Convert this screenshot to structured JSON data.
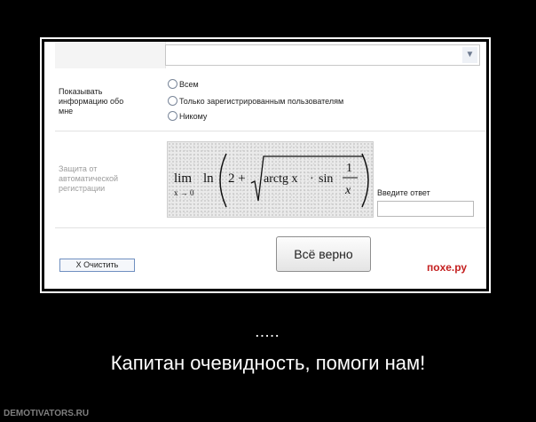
{
  "form": {
    "show_info_label": "Показывать информацию обо мне",
    "radios": [
      {
        "label": "Всем"
      },
      {
        "label": "Только зарегистрированным пользователям"
      },
      {
        "label": "Никому"
      }
    ],
    "captcha_label": "Защита от автоматической регистрации",
    "captcha_formula": {
      "lim": "lim",
      "limit_sub": "x → 0",
      "ln": "ln",
      "two_plus": "2 +",
      "arctg": "arctg x",
      "mult": "·",
      "sin": "sin",
      "num": "1",
      "den": "x"
    },
    "answer_label": "Введите ответ",
    "answer_value": "",
    "ok_button": "Всё верно",
    "clear_button": "X  Очистить"
  },
  "brand": "поxe.ру",
  "ellipsis": ".....",
  "caption": "Капитан очевидность, помоги нам!",
  "footer": "DEMOTIVATORS.RU"
}
